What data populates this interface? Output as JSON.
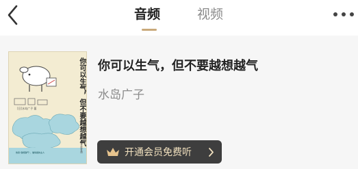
{
  "header": {
    "tabs": [
      {
        "label": "音频",
        "active": true
      },
      {
        "label": "视频",
        "active": false
      }
    ],
    "back_icon": "chevron-left-icon",
    "more_icon": "more-dots-icon"
  },
  "book": {
    "title": "你可以生气，但不要越想越气",
    "author": "水岛广子",
    "cover": {
      "title": "你可以生气，但不要越想越气",
      "author_line": "[日]水岛广子 著",
      "blurb": "告别“越想越气”，做情绪的主人",
      "publisher": "中信出版集团"
    }
  },
  "vip_button": {
    "label": "开通会员免费听",
    "icon": "crown-icon"
  },
  "colors": {
    "accent_gold": "#c9a97a",
    "button_dark": "#3e3e3e",
    "button_text": "#f2e1bf",
    "cover_teal": "#a9d6df"
  }
}
